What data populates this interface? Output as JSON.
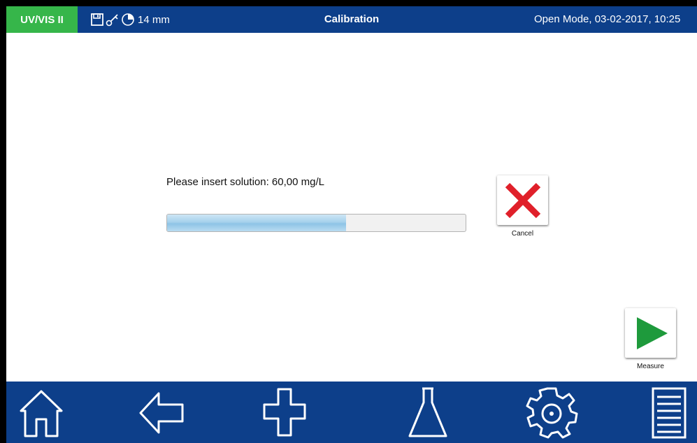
{
  "status_bar": {
    "mode": "UV/VIS II",
    "path_length": "14 mm",
    "title": "Calibration",
    "datetime": "Open Mode, 03-02-2017, 10:25",
    "icons": [
      "save-icon",
      "key-icon",
      "timer-icon"
    ]
  },
  "main": {
    "prompt": "Please insert solution: 60,00 mg/L",
    "progress": 0.6,
    "cancel_label": "Cancel",
    "measure_label": "Measure"
  },
  "nav": {
    "items": [
      "home-icon",
      "back-icon",
      "add-icon",
      "flask-icon",
      "settings-icon",
      "menu-icon"
    ]
  },
  "colors": {
    "bar": "#0d3f8a",
    "mode_badge": "#36b64a",
    "cancel": "#e0202a",
    "measure": "#1e9a3c"
  }
}
